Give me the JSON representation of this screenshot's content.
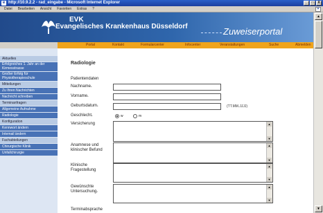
{
  "window": {
    "title": "http://10.9.2.2 - rad_eingabe - Microsoft Internet Explorer",
    "buttons": [
      "_",
      "□",
      "X"
    ]
  },
  "menubar": {
    "items": [
      "Datei",
      "Bearbeiten",
      "Ansicht",
      "Favoriten",
      "Extras",
      "?"
    ]
  },
  "header": {
    "short_name": "EVK",
    "long_name": "Evangelisches Krankenhaus Düsseldorf",
    "portal": "Zuweiserportal",
    "logo_icon": "dove-logo-icon"
  },
  "nav": {
    "items": [
      "Portal",
      "Kontakt",
      "Formularcenter",
      "Infocenter",
      "Veranstaltungen",
      "Suche",
      "Abmelden"
    ]
  },
  "sidebar": {
    "items": [
      {
        "kind": "section",
        "label": "Aktuelles"
      },
      {
        "kind": "link",
        "label": "Erfolgreiches 1. Jahr an der Kirmesstrasse"
      },
      {
        "kind": "link",
        "label": "Großer Erfolg für Physiotherapieschule"
      },
      {
        "kind": "section",
        "label": "Mitteilungen"
      },
      {
        "kind": "link",
        "label": "Zu Ihren Nachrichten"
      },
      {
        "kind": "link",
        "label": "Nachricht schreiben"
      },
      {
        "kind": "section",
        "label": "Terminanfragen"
      },
      {
        "kind": "link",
        "label": "Allgemeine Aufnahme"
      },
      {
        "kind": "link",
        "label": "Radiologie"
      },
      {
        "kind": "section",
        "label": "Konfiguration"
      },
      {
        "kind": "link",
        "label": "Kennwort ändern"
      },
      {
        "kind": "link",
        "label": "Intemail ändern"
      },
      {
        "kind": "section",
        "label": "Fachabteilungen"
      },
      {
        "kind": "link",
        "label": "Chirurgische Klinik"
      },
      {
        "kind": "link",
        "label": "Unfallchirurgie"
      }
    ]
  },
  "form": {
    "title": "Radiologie",
    "section": "Patientendaten",
    "nachname_label": "Nachname",
    "vorname_label": "Vorname",
    "geburtsdatum_label": "Geburtsdatum",
    "date_hint": "(TT.MM.JJJJ)",
    "geschlecht_label": "Geschlecht",
    "gender_w": "w",
    "gender_m": "m",
    "gender_selected": "w",
    "versicherung_label": "Versicherung",
    "anamnese_label": "Anamnese und klinischer Befund",
    "klinische_label": "Klinische Fragestellung",
    "gewuenschte_label": "Gewünschte Untersuchung",
    "terminabsprache_label": "Terminabsprache",
    "required_mark": "*"
  },
  "colors": {
    "header_blue": "#214a8b",
    "nav_orange": "#f0a41b",
    "sidebar_link": "#4872b6",
    "sidebar_section": "#b9cbe4"
  }
}
